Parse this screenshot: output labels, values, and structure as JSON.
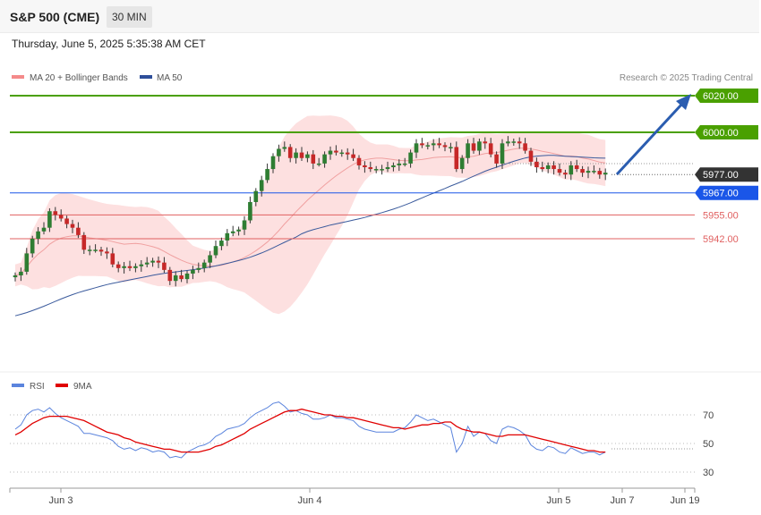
{
  "header": {
    "title": "S&P 500 (CME)",
    "interval": "30 MIN",
    "datetime": "Thursday, June 5, 2025 5:35:38 AM CET"
  },
  "legend_main": [
    {
      "label": "MA 20 + Bollinger Bands",
      "color": "#f48a8a"
    },
    {
      "label": "MA 50",
      "color": "#2e4f9a"
    }
  ],
  "credit": "Research © 2025 Trading Central",
  "legend_rsi": [
    {
      "label": "RSI",
      "color": "#5b84dd"
    },
    {
      "label": "9MA",
      "color": "#e00000"
    }
  ],
  "colors": {
    "up": "#2e7d32",
    "down": "#c62828",
    "band_fill": "#fde0e0",
    "ma20": "#f0a0a0",
    "ma50": "#3a5a9c",
    "resistance": "#4aa000",
    "pivot": "#1a56e8",
    "support": "#e06060",
    "current": "#333333",
    "arrow": "#2b5db0"
  },
  "chart_data": [
    {
      "type": "candlestick",
      "x_ticks": [
        "Jun 3",
        "Jun 4",
        "Jun 5",
        "Jun 7",
        "Jun 19"
      ],
      "ylim": [
        5880,
        6028
      ],
      "levels": [
        {
          "value": 6020.0,
          "label": "6020.00",
          "kind": "resistance"
        },
        {
          "value": 6000.0,
          "label": "6000.00",
          "kind": "resistance"
        },
        {
          "value": 5977.0,
          "label": "5977.00",
          "kind": "current"
        },
        {
          "value": 5967.0,
          "label": "5967.00",
          "kind": "pivot"
        },
        {
          "value": 5955.0,
          "label": "5955.00",
          "kind": "support"
        },
        {
          "value": 5942.0,
          "label": "5942.00",
          "kind": "support"
        }
      ],
      "closes": [
        5922,
        5924,
        5934,
        5942,
        5946,
        5948,
        5957,
        5955,
        5953,
        5950,
        5948,
        5944,
        5936,
        5936,
        5936,
        5935,
        5934,
        5928,
        5926,
        5927,
        5926,
        5927,
        5928,
        5929,
        5930,
        5929,
        5925,
        5919,
        5922,
        5920,
        5923,
        5925,
        5926,
        5929,
        5933,
        5938,
        5941,
        5945,
        5946,
        5947,
        5952,
        5962,
        5968,
        5974,
        5980,
        5987,
        5991,
        5992,
        5986,
        5989,
        5986,
        5988,
        5983,
        5983,
        5988,
        5990,
        5989,
        5989,
        5988,
        5986,
        5982,
        5981,
        5980,
        5980,
        5980,
        5981,
        5982,
        5983,
        5983,
        5989,
        5994,
        5993,
        5993,
        5994,
        5993,
        5992,
        5992,
        5980,
        5986,
        5994,
        5990,
        5995,
        5994,
        5988,
        5983,
        5994,
        5995,
        5995,
        5994,
        5990,
        5984,
        5981,
        5980,
        5982,
        5980,
        5978,
        5977,
        5982,
        5980,
        5978,
        5979,
        5979,
        5977,
        5978
      ]
    },
    {
      "type": "line",
      "title": "RSI",
      "yticks": [
        70,
        50,
        30
      ],
      "ylim": [
        20,
        82
      ],
      "series": [
        {
          "name": "RSI",
          "values": [
            60,
            63,
            70,
            73,
            74,
            72,
            75,
            71,
            68,
            66,
            64,
            62,
            57,
            57,
            56,
            55,
            54,
            52,
            48,
            46,
            47,
            45,
            47,
            46,
            44,
            45,
            44,
            40,
            41,
            40,
            44,
            46,
            48,
            49,
            51,
            55,
            57,
            60,
            61,
            62,
            64,
            68,
            71,
            73,
            75,
            78,
            79,
            76,
            72,
            73,
            71,
            70,
            67,
            67,
            68,
            70,
            68,
            68,
            67,
            66,
            62,
            60,
            59,
            58,
            58,
            58,
            58,
            60,
            61,
            65,
            70,
            68,
            66,
            67,
            65,
            63,
            61,
            44,
            50,
            62,
            55,
            58,
            57,
            52,
            50,
            60,
            62,
            61,
            59,
            56,
            49,
            46,
            45,
            48,
            47,
            44,
            43,
            47,
            45,
            43,
            44,
            44,
            42,
            44
          ]
        },
        {
          "name": "9MA",
          "values": [
            56,
            58,
            61,
            64,
            66,
            68,
            69,
            69,
            69,
            69,
            68,
            67,
            66,
            64,
            62,
            60,
            58,
            57,
            56,
            54,
            53,
            51,
            50,
            49,
            48,
            47,
            46,
            46,
            45,
            44,
            44,
            44,
            44,
            45,
            46,
            48,
            49,
            51,
            53,
            55,
            57,
            60,
            62,
            64,
            66,
            68,
            70,
            72,
            73,
            73,
            74,
            73,
            72,
            71,
            70,
            70,
            69,
            69,
            68,
            68,
            67,
            66,
            65,
            64,
            63,
            62,
            61,
            61,
            60,
            61,
            62,
            63,
            63,
            64,
            64,
            65,
            65,
            62,
            60,
            59,
            58,
            58,
            57,
            56,
            55,
            55,
            56,
            56,
            56,
            56,
            55,
            54,
            53,
            52,
            51,
            50,
            49,
            48,
            47,
            46,
            45,
            45,
            44,
            44
          ]
        }
      ]
    }
  ]
}
